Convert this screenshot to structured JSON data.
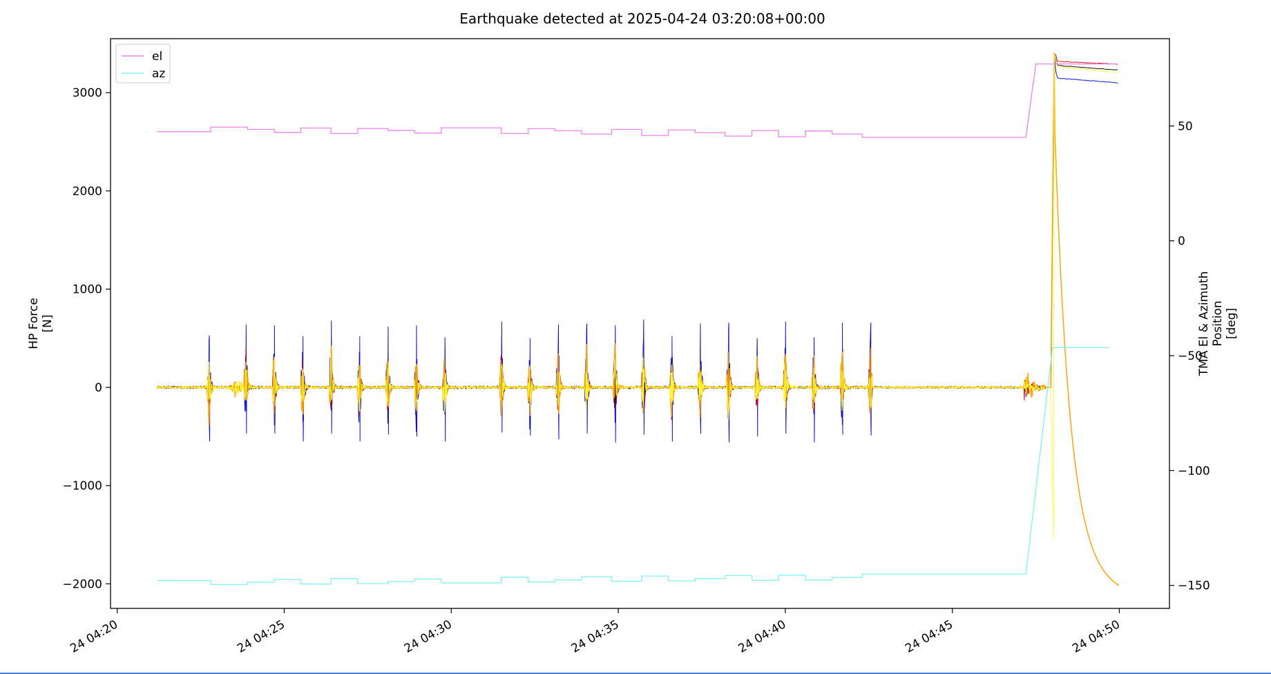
{
  "chart_data": {
    "type": "line",
    "title": "Earthquake detected at 2025-04-24 03:20:08+00:00",
    "ylabel_left": [
      "HP Force",
      "[N]"
    ],
    "ylabel_right": [
      "TMA El & Azimuth",
      "Position",
      "[deg]"
    ],
    "x_unit": "minutes after 24 04:20",
    "xlim": [
      -0.2,
      31.5
    ],
    "ylim_left": [
      -2250,
      3550
    ],
    "ylim_right": [
      -160,
      88
    ],
    "x_ticks": [
      {
        "value": 0,
        "label": "24 04:20"
      },
      {
        "value": 5,
        "label": "24 04:25"
      },
      {
        "value": 10,
        "label": "24 04:30"
      },
      {
        "value": 15,
        "label": "24 04:35"
      },
      {
        "value": 20,
        "label": "24 04:40"
      },
      {
        "value": 25,
        "label": "24 04:45"
      },
      {
        "value": 30,
        "label": "24 04:50"
      }
    ],
    "left_ticks": [
      {
        "value": 3000,
        "label": "3000"
      },
      {
        "value": 2000,
        "label": "2000"
      },
      {
        "value": 1000,
        "label": "1000"
      },
      {
        "value": 0,
        "label": "0"
      },
      {
        "value": -1000,
        "label": "−1000"
      },
      {
        "value": -2000,
        "label": "−2000"
      }
    ],
    "right_ticks": [
      {
        "value": 50,
        "label": "50"
      },
      {
        "value": 0,
        "label": "0"
      },
      {
        "value": -50,
        "label": "−50"
      },
      {
        "value": -100,
        "label": "−100"
      },
      {
        "value": -150,
        "label": "−150"
      }
    ],
    "legend": {
      "placement": "top-left"
    },
    "series": [
      {
        "name": "el",
        "axis": "right",
        "color": "#ee82ee",
        "points": [
          [
            1.2,
            47.5
          ],
          [
            2.8,
            47.5
          ],
          [
            2.8,
            49.5
          ],
          [
            3.9,
            49.5
          ],
          [
            3.9,
            48.5
          ],
          [
            4.7,
            48.5
          ],
          [
            4.7,
            47.2
          ],
          [
            5.5,
            47.2
          ],
          [
            5.5,
            49.1
          ],
          [
            6.4,
            49.1
          ],
          [
            6.4,
            46.7
          ],
          [
            7.2,
            46.7
          ],
          [
            7.2,
            48.9
          ],
          [
            8.1,
            48.9
          ],
          [
            8.1,
            48.1
          ],
          [
            8.9,
            48.1
          ],
          [
            8.9,
            46.9
          ],
          [
            9.7,
            46.9
          ],
          [
            9.7,
            49.2
          ],
          [
            11.5,
            49.2
          ],
          [
            11.5,
            46.7
          ],
          [
            12.3,
            46.7
          ],
          [
            12.3,
            48.8
          ],
          [
            13.1,
            48.8
          ],
          [
            13.1,
            47.9
          ],
          [
            13.9,
            47.9
          ],
          [
            13.9,
            46.5
          ],
          [
            14.8,
            46.5
          ],
          [
            14.8,
            48.5
          ],
          [
            15.7,
            48.5
          ],
          [
            15.7,
            45.9
          ],
          [
            16.5,
            45.9
          ],
          [
            16.5,
            48.3
          ],
          [
            17.3,
            48.3
          ],
          [
            17.3,
            47.1
          ],
          [
            18.2,
            47.1
          ],
          [
            18.2,
            45.6
          ],
          [
            19.0,
            45.6
          ],
          [
            19.0,
            48.0
          ],
          [
            19.8,
            48.0
          ],
          [
            19.8,
            45.3
          ],
          [
            20.6,
            45.3
          ],
          [
            20.6,
            47.8
          ],
          [
            21.4,
            47.8
          ],
          [
            21.4,
            46.5
          ],
          [
            22.3,
            46.5
          ],
          [
            22.3,
            45.0
          ],
          [
            27.2,
            45.0
          ],
          [
            27.5,
            77.0
          ],
          [
            29.9,
            77.0
          ]
        ]
      },
      {
        "name": "az",
        "axis": "right",
        "color": "#7ff2f2",
        "points": [
          [
            1.2,
            -147.9
          ],
          [
            2.8,
            -147.9
          ],
          [
            2.8,
            -149.6
          ],
          [
            3.9,
            -149.6
          ],
          [
            3.9,
            -148.6
          ],
          [
            4.7,
            -148.6
          ],
          [
            4.7,
            -147.5
          ],
          [
            5.5,
            -147.5
          ],
          [
            5.5,
            -149.4
          ],
          [
            6.4,
            -149.4
          ],
          [
            6.4,
            -147.0
          ],
          [
            7.2,
            -147.0
          ],
          [
            7.2,
            -149.2
          ],
          [
            8.1,
            -149.2
          ],
          [
            8.1,
            -148.3
          ],
          [
            8.9,
            -148.3
          ],
          [
            8.9,
            -147.2
          ],
          [
            9.7,
            -147.2
          ],
          [
            9.7,
            -148.9
          ],
          [
            11.5,
            -148.9
          ],
          [
            11.5,
            -146.4
          ],
          [
            12.3,
            -146.4
          ],
          [
            12.3,
            -148.5
          ],
          [
            13.1,
            -148.5
          ],
          [
            13.1,
            -147.6
          ],
          [
            13.9,
            -147.6
          ],
          [
            13.9,
            -146.2
          ],
          [
            14.8,
            -146.2
          ],
          [
            14.8,
            -148.2
          ],
          [
            15.7,
            -148.2
          ],
          [
            15.7,
            -145.9
          ],
          [
            16.5,
            -145.9
          ],
          [
            16.5,
            -148.0
          ],
          [
            17.3,
            -148.0
          ],
          [
            17.3,
            -147.0
          ],
          [
            18.2,
            -147.0
          ],
          [
            18.2,
            -145.7
          ],
          [
            19.0,
            -145.7
          ],
          [
            19.0,
            -147.8
          ],
          [
            19.8,
            -147.8
          ],
          [
            19.8,
            -145.5
          ],
          [
            20.6,
            -145.5
          ],
          [
            20.6,
            -147.6
          ],
          [
            21.4,
            -147.6
          ],
          [
            21.4,
            -146.5
          ],
          [
            22.3,
            -146.5
          ],
          [
            22.3,
            -145.1
          ],
          [
            27.2,
            -145.1
          ],
          [
            28.0,
            -46.5
          ],
          [
            29.7,
            -46.5
          ]
        ]
      }
    ],
    "force_actuators": {
      "axis": "left",
      "colors": [
        "#0000dd",
        "#dd0000",
        "#000000",
        "#ffa500",
        "#ffff33"
      ],
      "x_range": [
        1.2,
        22.5
      ],
      "pulse_times": [
        2.75,
        3.85,
        4.7,
        5.55,
        6.4,
        7.25,
        8.1,
        8.95,
        9.8,
        11.5,
        12.35,
        13.2,
        14.05,
        14.9,
        15.75,
        16.6,
        17.45,
        18.3,
        19.15,
        20.0,
        20.85,
        21.7,
        22.55
      ],
      "pulse_max_values": [
        530,
        640,
        630,
        520,
        680,
        520,
        620,
        630,
        510,
        670,
        500,
        640,
        650,
        630,
        690,
        520,
        650,
        660,
        500,
        670,
        510,
        660,
        660
      ],
      "pulse_min_values": [
        -550,
        -470,
        -470,
        -550,
        -470,
        -550,
        -480,
        -500,
        -550,
        -460,
        -490,
        -530,
        -470,
        -560,
        -480,
        -550,
        -470,
        -560,
        -500,
        -470,
        -560,
        -480,
        -490
      ],
      "burst_time": 3.6,
      "burst_amplitude": 150,
      "end_event_time": 27.2,
      "spike_time": 28.05,
      "spike_max": 3400,
      "spike_min": -1550,
      "final_levels": [
        {
          "color": "#0000dd",
          "start": 3150,
          "end": 3100
        },
        {
          "color": "#dd0000",
          "start": 3320,
          "end": 3290
        },
        {
          "color": "#000000",
          "start": 3280,
          "end": 3230
        },
        {
          "color": "#ffff33",
          "start": 3270,
          "end": 3200
        }
      ],
      "decay": {
        "color": "#ffa500",
        "start": 2800,
        "end": -1970,
        "end_time": 30.0
      }
    }
  }
}
